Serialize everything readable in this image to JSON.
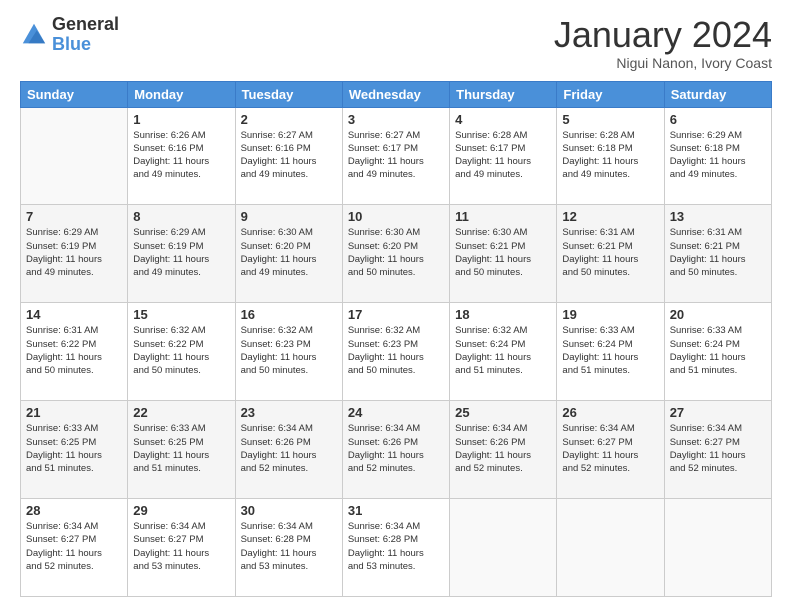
{
  "header": {
    "logo_line1": "General",
    "logo_line2": "Blue",
    "title": "January 2024",
    "subtitle": "Nigui Nanon, Ivory Coast"
  },
  "weekdays": [
    "Sunday",
    "Monday",
    "Tuesday",
    "Wednesday",
    "Thursday",
    "Friday",
    "Saturday"
  ],
  "weeks": [
    [
      {
        "day": "",
        "info": ""
      },
      {
        "day": "1",
        "info": "Sunrise: 6:26 AM\nSunset: 6:16 PM\nDaylight: 11 hours\nand 49 minutes."
      },
      {
        "day": "2",
        "info": "Sunrise: 6:27 AM\nSunset: 6:16 PM\nDaylight: 11 hours\nand 49 minutes."
      },
      {
        "day": "3",
        "info": "Sunrise: 6:27 AM\nSunset: 6:17 PM\nDaylight: 11 hours\nand 49 minutes."
      },
      {
        "day": "4",
        "info": "Sunrise: 6:28 AM\nSunset: 6:17 PM\nDaylight: 11 hours\nand 49 minutes."
      },
      {
        "day": "5",
        "info": "Sunrise: 6:28 AM\nSunset: 6:18 PM\nDaylight: 11 hours\nand 49 minutes."
      },
      {
        "day": "6",
        "info": "Sunrise: 6:29 AM\nSunset: 6:18 PM\nDaylight: 11 hours\nand 49 minutes."
      }
    ],
    [
      {
        "day": "7",
        "info": "Sunrise: 6:29 AM\nSunset: 6:19 PM\nDaylight: 11 hours\nand 49 minutes."
      },
      {
        "day": "8",
        "info": "Sunrise: 6:29 AM\nSunset: 6:19 PM\nDaylight: 11 hours\nand 49 minutes."
      },
      {
        "day": "9",
        "info": "Sunrise: 6:30 AM\nSunset: 6:20 PM\nDaylight: 11 hours\nand 49 minutes."
      },
      {
        "day": "10",
        "info": "Sunrise: 6:30 AM\nSunset: 6:20 PM\nDaylight: 11 hours\nand 50 minutes."
      },
      {
        "day": "11",
        "info": "Sunrise: 6:30 AM\nSunset: 6:21 PM\nDaylight: 11 hours\nand 50 minutes."
      },
      {
        "day": "12",
        "info": "Sunrise: 6:31 AM\nSunset: 6:21 PM\nDaylight: 11 hours\nand 50 minutes."
      },
      {
        "day": "13",
        "info": "Sunrise: 6:31 AM\nSunset: 6:21 PM\nDaylight: 11 hours\nand 50 minutes."
      }
    ],
    [
      {
        "day": "14",
        "info": "Sunrise: 6:31 AM\nSunset: 6:22 PM\nDaylight: 11 hours\nand 50 minutes."
      },
      {
        "day": "15",
        "info": "Sunrise: 6:32 AM\nSunset: 6:22 PM\nDaylight: 11 hours\nand 50 minutes."
      },
      {
        "day": "16",
        "info": "Sunrise: 6:32 AM\nSunset: 6:23 PM\nDaylight: 11 hours\nand 50 minutes."
      },
      {
        "day": "17",
        "info": "Sunrise: 6:32 AM\nSunset: 6:23 PM\nDaylight: 11 hours\nand 50 minutes."
      },
      {
        "day": "18",
        "info": "Sunrise: 6:32 AM\nSunset: 6:24 PM\nDaylight: 11 hours\nand 51 minutes."
      },
      {
        "day": "19",
        "info": "Sunrise: 6:33 AM\nSunset: 6:24 PM\nDaylight: 11 hours\nand 51 minutes."
      },
      {
        "day": "20",
        "info": "Sunrise: 6:33 AM\nSunset: 6:24 PM\nDaylight: 11 hours\nand 51 minutes."
      }
    ],
    [
      {
        "day": "21",
        "info": "Sunrise: 6:33 AM\nSunset: 6:25 PM\nDaylight: 11 hours\nand 51 minutes."
      },
      {
        "day": "22",
        "info": "Sunrise: 6:33 AM\nSunset: 6:25 PM\nDaylight: 11 hours\nand 51 minutes."
      },
      {
        "day": "23",
        "info": "Sunrise: 6:34 AM\nSunset: 6:26 PM\nDaylight: 11 hours\nand 52 minutes."
      },
      {
        "day": "24",
        "info": "Sunrise: 6:34 AM\nSunset: 6:26 PM\nDaylight: 11 hours\nand 52 minutes."
      },
      {
        "day": "25",
        "info": "Sunrise: 6:34 AM\nSunset: 6:26 PM\nDaylight: 11 hours\nand 52 minutes."
      },
      {
        "day": "26",
        "info": "Sunrise: 6:34 AM\nSunset: 6:27 PM\nDaylight: 11 hours\nand 52 minutes."
      },
      {
        "day": "27",
        "info": "Sunrise: 6:34 AM\nSunset: 6:27 PM\nDaylight: 11 hours\nand 52 minutes."
      }
    ],
    [
      {
        "day": "28",
        "info": "Sunrise: 6:34 AM\nSunset: 6:27 PM\nDaylight: 11 hours\nand 52 minutes."
      },
      {
        "day": "29",
        "info": "Sunrise: 6:34 AM\nSunset: 6:27 PM\nDaylight: 11 hours\nand 53 minutes."
      },
      {
        "day": "30",
        "info": "Sunrise: 6:34 AM\nSunset: 6:28 PM\nDaylight: 11 hours\nand 53 minutes."
      },
      {
        "day": "31",
        "info": "Sunrise: 6:34 AM\nSunset: 6:28 PM\nDaylight: 11 hours\nand 53 minutes."
      },
      {
        "day": "",
        "info": ""
      },
      {
        "day": "",
        "info": ""
      },
      {
        "day": "",
        "info": ""
      }
    ]
  ]
}
